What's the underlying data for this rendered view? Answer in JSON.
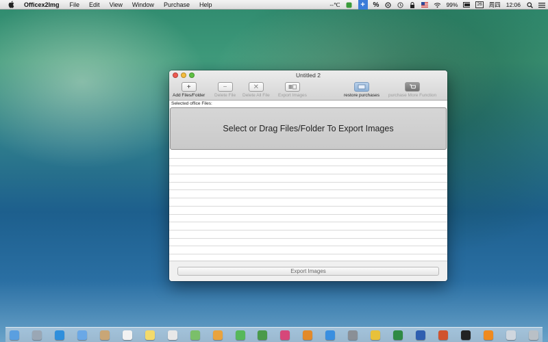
{
  "menubar": {
    "app_name": "Officex2Img",
    "items": [
      "File",
      "Edit",
      "View",
      "Window",
      "Purchase",
      "Help"
    ],
    "status": {
      "temperature": "--℃",
      "plus": "+",
      "percent": "%",
      "battery": "99%",
      "calendar_day": "26",
      "weekday": "周四",
      "time": "12:06"
    }
  },
  "window": {
    "title": "Untitled 2",
    "toolbar": {
      "add_files_folder": "Add Files/Folder",
      "delete_file": "Delete File",
      "delete_all_file": "Delete All File",
      "export_images": "Export Images",
      "restore_purchases": "restore purchases",
      "purchase_more_function": "purchase More Function"
    },
    "selected_label": "Selected office Files:",
    "dropzone_text": "Select or Drag Files/Folder To Export Images",
    "export_button": "Export Images"
  },
  "colors": {
    "close": "#ee5a52",
    "minimize": "#f4bc3e",
    "zoom": "#5fc243"
  },
  "dock": {
    "icons": [
      "finder-icon",
      "launchpad-icon",
      "safari-icon",
      "mail-icon",
      "contacts-icon",
      "calendar-icon",
      "notes-icon",
      "reminders-icon",
      "maps-icon",
      "photos-icon",
      "messages-icon",
      "facetime-icon",
      "itunes-icon",
      "ibooks-icon",
      "app-store-icon",
      "system-preferences-icon",
      "chrome-icon",
      "excel-icon",
      "word-icon",
      "powerpoint-icon",
      "terminal-icon",
      "vlc-icon",
      "preview-icon",
      "trash-icon"
    ]
  }
}
